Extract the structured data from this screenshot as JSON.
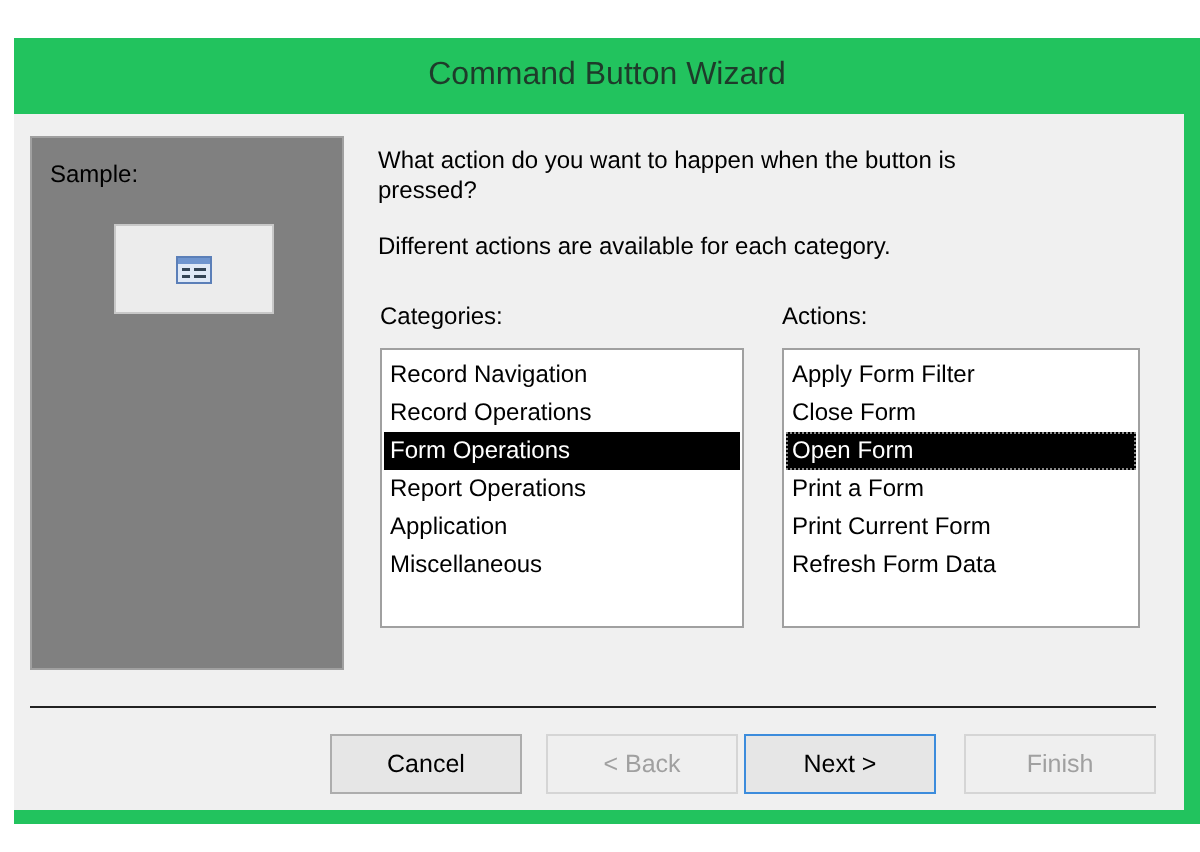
{
  "window": {
    "title": "Command Button Wizard"
  },
  "sample": {
    "label": "Sample:"
  },
  "prompt": "What action do you want to happen when the button is pressed?",
  "hint": "Different actions are available for each category.",
  "lists": [
    {
      "label": "Categories:",
      "focused": false,
      "items": [
        {
          "label": "Record Navigation",
          "selected": false
        },
        {
          "label": "Record Operations",
          "selected": false
        },
        {
          "label": "Form Operations",
          "selected": true
        },
        {
          "label": "Report Operations",
          "selected": false
        },
        {
          "label": "Application",
          "selected": false
        },
        {
          "label": "Miscellaneous",
          "selected": false
        }
      ]
    },
    {
      "label": "Actions:",
      "focused": true,
      "items": [
        {
          "label": "Apply Form Filter",
          "selected": false
        },
        {
          "label": "Close Form",
          "selected": false
        },
        {
          "label": "Open Form",
          "selected": true
        },
        {
          "label": "Print a Form",
          "selected": false
        },
        {
          "label": "Print Current Form",
          "selected": false
        },
        {
          "label": "Refresh Form Data",
          "selected": false
        }
      ]
    }
  ],
  "buttons": [
    {
      "label": "Cancel",
      "disabled": false,
      "default": false
    },
    {
      "label": "< Back",
      "disabled": true,
      "default": false
    },
    {
      "label": "Next >",
      "disabled": false,
      "default": true
    },
    {
      "label": "Finish",
      "disabled": true,
      "default": false
    }
  ]
}
